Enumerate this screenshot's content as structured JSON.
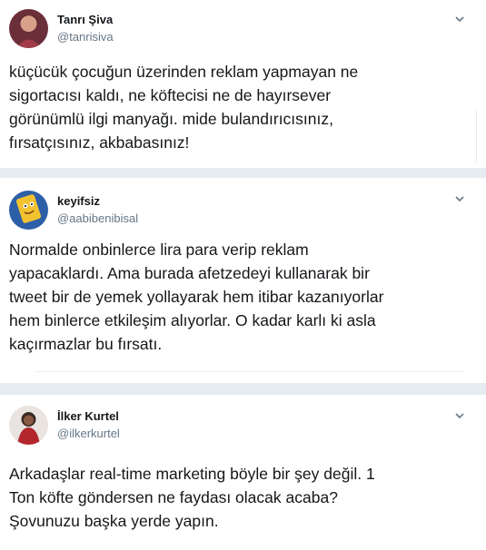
{
  "tweets": [
    {
      "name": "Tanrı Şiva",
      "handle": "@tanrisiva",
      "avatar_icon": "avatar-photo-icon",
      "text": "küçücük çocuğun üzerinden reklam yapmayan ne\nsigortacısı kaldı, ne köftecisi ne de hayırsever\ngörünümlü ilgi manyağı. mide bulandırıcısınız,\nfırsatçısınız, akbabasınız!"
    },
    {
      "name": "keyifsiz",
      "handle": "@aabibenibisal",
      "avatar_icon": "cartoon-avatar-icon",
      "text": "Normalde onbinlerce lira para verip reklam\nyapacaklardı. Ama burada afetzedeyi kullanarak bir\ntweet bir de yemek yollayarak hem itibar kazanıyorlar\nhem binlerce etkileşim alıyorlar. O kadar karlı ki asla\nkaçırmazlar bu fırsatı."
    },
    {
      "name": "İlker Kurtel",
      "handle": "@ilkerkurtel",
      "avatar_icon": "avatar-photo-icon",
      "text": "Arkadaşlar real-time marketing böyle bir şey değil. 1\nTon köfte göndersen ne faydası olacak acaba?\nŞovunuzu başka yerde yapın."
    }
  ],
  "colors": {
    "name": "#14171a",
    "handle": "#657786",
    "separator": "#e6ecf0",
    "chevron": "#657786"
  }
}
